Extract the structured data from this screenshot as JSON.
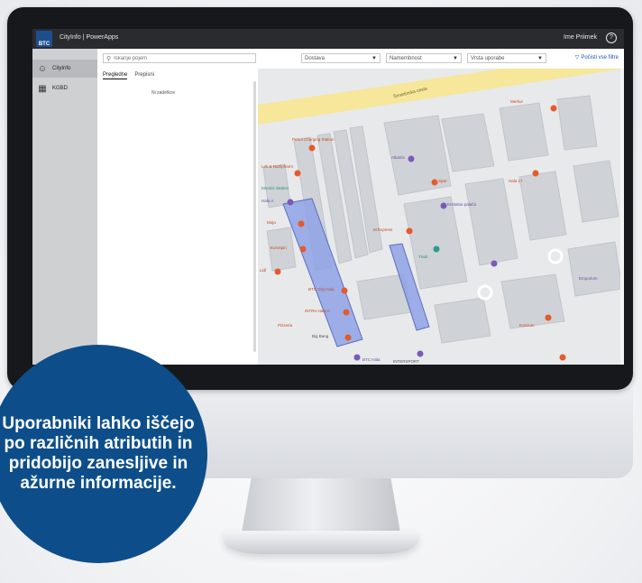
{
  "app": {
    "logo_text": "BTC",
    "title": "CityInfo | PowerApps",
    "user_name": "Ime Priimek",
    "user_icon": "user-circle-icon"
  },
  "sidebar": {
    "items": [
      {
        "label": "CityInfo",
        "icon": "user-group-icon",
        "active": true
      },
      {
        "label": "KGBD",
        "icon": "building-icon",
        "active": false
      }
    ]
  },
  "filters": {
    "search_placeholder": "Iskanje pojem",
    "dropdowns": [
      "Dostava",
      "Namembnost",
      "Vrsta uporabe"
    ],
    "reset_label": "Počisti vse filtre"
  },
  "list": {
    "tabs": [
      "Pregledne",
      "Prepisni"
    ],
    "active_tab": 0,
    "empty_text": "Ni zadetkov"
  },
  "map": {
    "street": "Šmartinska cesta",
    "pins_orange": [
      "Petrol Charging Station",
      "Lek & Nutripharm",
      "Moja",
      "Eurospin",
      "Lidl",
      "M Express",
      "Pizzeria",
      "BTC City Hala",
      "INTRA Hala A",
      "Big Bang",
      "Spar",
      "Hala 17",
      "Merkur",
      "INTERSPORT",
      "Konzum"
    ],
    "pins_purple": [
      "Hala A",
      "Kristalna palača",
      "Atlantis",
      "Emporium",
      "BTC Hala"
    ],
    "pins_teal": [
      "Electric Station",
      "Tivoli"
    ]
  },
  "badge": {
    "text": "Uporabniki lahko iščejo po različnih atributih in pridobijo zanesljive in ažurne informacije."
  },
  "colors": {
    "accent": "#1d4f8c",
    "badge": "#0d4e8a",
    "pin_orange": "#e55a2b",
    "pin_purple": "#7a5ab8",
    "pin_teal": "#2a9d8f",
    "zone_fill": "#8ea2e6",
    "road": "#f6e79a"
  }
}
